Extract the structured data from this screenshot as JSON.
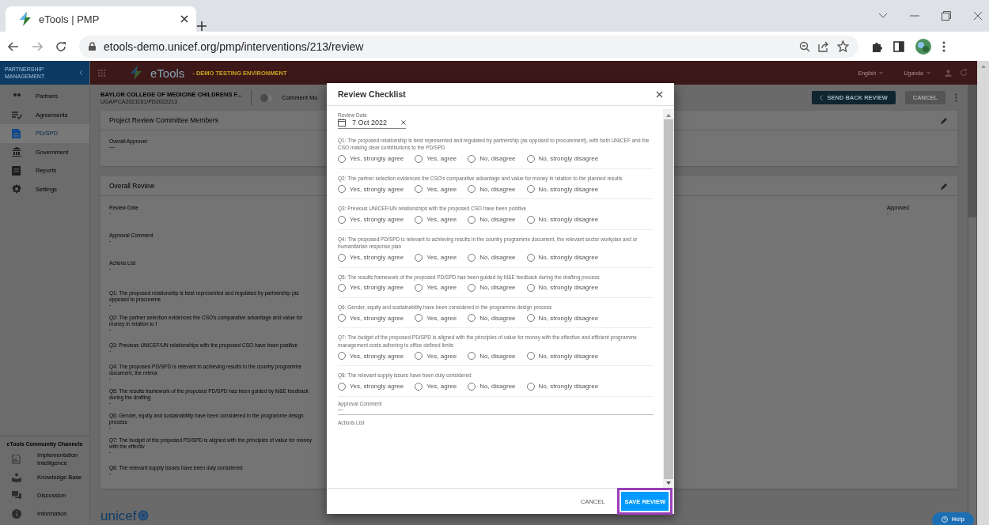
{
  "browser": {
    "tab_title": "eTools | PMP",
    "url": "etools-demo.unicef.org/pmp/interventions/213/review"
  },
  "sidebar": {
    "title": "PARTNERSHIP MANAGEMENT",
    "items": [
      {
        "label": "Partners",
        "selected": false
      },
      {
        "label": "Agreements",
        "selected": false
      },
      {
        "label": "PD/SPD",
        "selected": true
      },
      {
        "label": "Government",
        "selected": false
      },
      {
        "label": "Reports",
        "selected": false
      },
      {
        "label": "Settings",
        "selected": false
      }
    ],
    "community": {
      "title": "eTools Community Channels",
      "items": [
        {
          "label": "Implementation Intelligence"
        },
        {
          "label": "Knowledge Base"
        },
        {
          "label": "Discussion"
        },
        {
          "label": "Information"
        }
      ]
    }
  },
  "topbar": {
    "app_name": "eTools",
    "environment": "- DEMO TESTING ENVIRONMENT",
    "language": "English",
    "country": "Uganda"
  },
  "header": {
    "partner": "BAYLOR COLLEGE OF MEDICINE CHILDRENS F...",
    "reference": "UGA/PCA2021161/PD2022213",
    "comment_mode": {
      "label": "Comment Mo",
      "on": false
    },
    "buttons": [
      {
        "label": "SEND BACK REVIEW",
        "kind": "primary"
      },
      {
        "label": "CANCEL",
        "kind": "secondary"
      }
    ]
  },
  "committee_card": {
    "title": "Project Review Committee Members",
    "fields": [
      {
        "label": "Overall Approver",
        "value": "—"
      }
    ]
  },
  "overall_review": {
    "title": "Overall Review",
    "fields": [
      {
        "label": "Review Date",
        "value": "-"
      },
      {
        "label": "Approval Comment",
        "value": "-"
      },
      {
        "label": "Actions List",
        "value": "-"
      }
    ],
    "approved": {
      "label": "Approved",
      "value": "-"
    },
    "questions": [
      {
        "text": "Q1: The proposed relationship is best represented and regulated by partnership (as opposed to procureme",
        "answer": "-"
      },
      {
        "text": "Q2: The partner selection evidences the CSO's comparative advantage and value for money in relation to t",
        "answer": "-"
      },
      {
        "text": "Q3: Previous UNICEF/UN relationships with the proposed CSO have been positive",
        "answer": "-"
      },
      {
        "text": "Q4: The proposed PD/SPD is relevant to achieving results in the country programme document, the releva",
        "answer": "-"
      },
      {
        "text": "Q5: The results framework of the proposed PD/SPD has been guided by M&E feedback during the drafting",
        "answer": "-"
      },
      {
        "text": "Q6: Gender, equity and sustainability have been considered in the programme design process",
        "answer": "-"
      },
      {
        "text": "Q7: The budget of the proposed PD/SPD is aligned with the principles of value for money with the effectiv",
        "answer": "-"
      },
      {
        "text": "Q8: The relevant supply issues have been duly considered",
        "answer": "-"
      }
    ]
  },
  "footer": {
    "logo": "unicef",
    "help": "Help"
  },
  "dialog": {
    "title": "Review Checklist",
    "review_date": {
      "label": "Review Date",
      "value": "7 Oct 2022"
    },
    "questions": [
      {
        "text": "Q1: The proposed relationship is best represented and regulated by partnership (as opposed to procurement), with both UNICEF and the CSO making clear contributions to the PD/SPD",
        "options": [
          {
            "label": "Yes, strongly agree",
            "selected": false
          },
          {
            "label": "Yes, agree",
            "selected": false
          },
          {
            "label": "No, disagree",
            "selected": false
          },
          {
            "label": "No, strongly disagree",
            "selected": false
          }
        ]
      },
      {
        "text": "Q2: The partner selection evidences the CSO's comparative advantage and value for money in relation to the planned results",
        "options": [
          {
            "label": "Yes, strongly agree",
            "selected": false
          },
          {
            "label": "Yes, agree",
            "selected": false
          },
          {
            "label": "No, disagree",
            "selected": false
          },
          {
            "label": "No, strongly disagree",
            "selected": false
          }
        ]
      },
      {
        "text": "Q3: Previous UNICEF/UN relationships with the proposed CSO have been positive",
        "options": [
          {
            "label": "Yes, strongly agree",
            "selected": false
          },
          {
            "label": "Yes, agree",
            "selected": false
          },
          {
            "label": "No, disagree",
            "selected": false
          },
          {
            "label": "No, strongly disagree",
            "selected": false
          }
        ]
      },
      {
        "text": "Q4: The proposed PD/SPD is relevant to achieving results in the country programme document, the relevant sector workplan and or humanitarian response plan",
        "options": [
          {
            "label": "Yes, strongly agree",
            "selected": false
          },
          {
            "label": "Yes, agree",
            "selected": false
          },
          {
            "label": "No, disagree",
            "selected": false
          },
          {
            "label": "No, strongly disagree",
            "selected": false
          }
        ]
      },
      {
        "text": "Q5: The results framework of the proposed PD/SPD has been guided by M&E feedback during the drafting process",
        "options": [
          {
            "label": "Yes, strongly agree",
            "selected": false
          },
          {
            "label": "Yes, agree",
            "selected": false
          },
          {
            "label": "No, disagree",
            "selected": false
          },
          {
            "label": "No, strongly disagree",
            "selected": false
          }
        ]
      },
      {
        "text": "Q6: Gender, equity and sustainability have been considered in the programme design process",
        "options": [
          {
            "label": "Yes, strongly agree",
            "selected": false
          },
          {
            "label": "Yes, agree",
            "selected": false
          },
          {
            "label": "No, disagree",
            "selected": false
          },
          {
            "label": "No, strongly disagree",
            "selected": false
          }
        ]
      },
      {
        "text": "Q7: The budget of the proposed PD/SPD is aligned with the principles of value for money with the effective and efficient programme management costs adhering to office defined limits",
        "options": [
          {
            "label": "Yes, strongly agree",
            "selected": false
          },
          {
            "label": "Yes, agree",
            "selected": false
          },
          {
            "label": "No, disagree",
            "selected": false
          },
          {
            "label": "No, strongly disagree",
            "selected": false
          }
        ]
      },
      {
        "text": "Q8: The relevant supply issues have been duly considered",
        "options": [
          {
            "label": "Yes, strongly agree",
            "selected": false
          },
          {
            "label": "Yes, agree",
            "selected": false
          },
          {
            "label": "No, disagree",
            "selected": false
          },
          {
            "label": "No, strongly disagree",
            "selected": false
          }
        ]
      }
    ],
    "approval_comment": {
      "label": "Approval Comment",
      "value": "—"
    },
    "actions_list": {
      "label": "Actions List"
    },
    "buttons": [
      {
        "label": "CANCEL",
        "kind": "text",
        "highlighted": false
      },
      {
        "label": "SAVE REVIEW",
        "kind": "primary",
        "highlighted": true
      }
    ]
  }
}
